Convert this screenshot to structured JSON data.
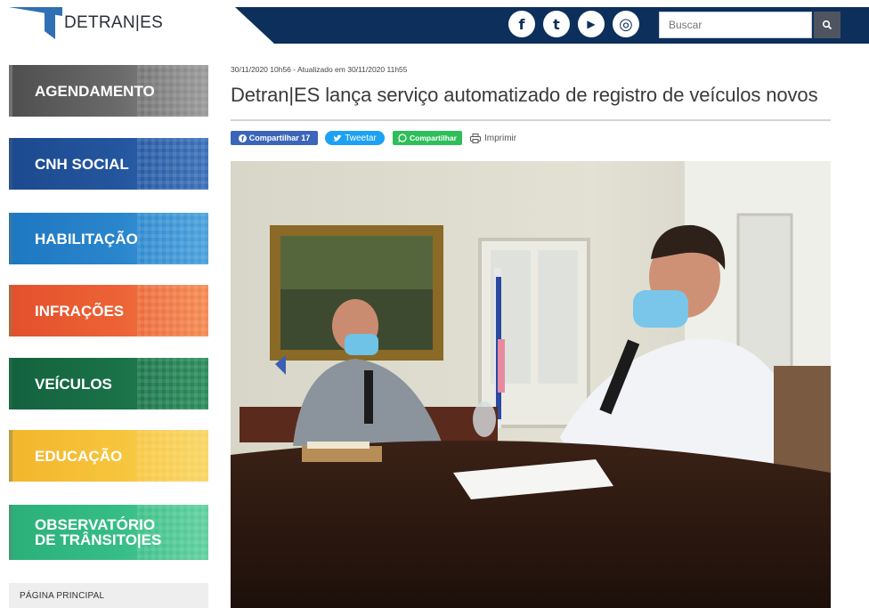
{
  "header": {
    "logo_text": "DETRAN|ES",
    "social": [
      {
        "icon": "facebook-icon",
        "glyph": "f"
      },
      {
        "icon": "twitter-icon",
        "glyph": "t"
      },
      {
        "icon": "youtube-icon",
        "glyph": "▶"
      },
      {
        "icon": "instagram-icon",
        "glyph": "◎"
      }
    ],
    "search": {
      "placeholder": "Buscar"
    }
  },
  "sidebar": {
    "items": [
      {
        "label": "AGENDAMENTO"
      },
      {
        "label": "CNH SOCIAL"
      },
      {
        "label": "HABILITAÇÃO"
      },
      {
        "label": "INFRAÇÕES"
      },
      {
        "label": "VEÍCULOS"
      },
      {
        "label": "EDUCAÇÃO"
      },
      {
        "label_line1": "OBSERVATÓRIO",
        "label_line2": "DE TRÂNSITO|ES"
      }
    ],
    "home_link": "PÁGINA PRINCIPAL"
  },
  "article": {
    "meta": "30/11/2020 10h56 - Atualizado em 30/11/2020 11h55",
    "title": "Detran|ES lança serviço automatizado de registro de veículos novos",
    "share": {
      "facebook": "Compartilhar 17",
      "twitter": "Tweetar",
      "whatsapp": "Compartilhar",
      "print": "Imprimir"
    }
  },
  "colors": {
    "topbar": "#0d2f5b",
    "agendamento": "#5a5a5a",
    "cnh_social": "#1d4a8f",
    "habilitacao": "#1e78c2",
    "infracoes": "#e4502d",
    "veiculos": "#14623f",
    "educacao": "#f3b62d",
    "observatorio": "#2bb07a"
  }
}
